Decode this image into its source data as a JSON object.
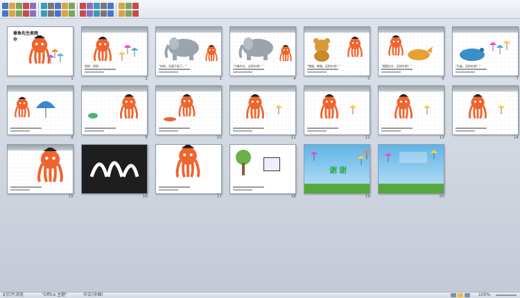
{
  "toolbar": {
    "row1_buttons": [
      "new",
      "open",
      "save",
      "print",
      "preview",
      "spell",
      "cut",
      "copy",
      "paste",
      "format-painter",
      "undo",
      "redo",
      "table",
      "chart",
      "sort",
      "drawing",
      "zoom",
      "help"
    ],
    "row2_buttons": [
      "font",
      "size",
      "bold",
      "italic",
      "underline",
      "shadow",
      "align-left",
      "center",
      "align-right",
      "justify",
      "numbering",
      "bullets",
      "indent",
      "outdent",
      "font-color",
      "styles",
      "search",
      "help"
    ]
  },
  "slides": [
    {
      "num": "1",
      "title": "章鱼先生卖雨伞",
      "theme": "title"
    },
    {
      "num": "2",
      "text": "阴阴、阴阴……",
      "theme": "octopus"
    },
    {
      "num": "3",
      "text": "\"哎呀，天要下雨了。\"",
      "theme": "elephant"
    },
    {
      "num": "4",
      "text": "\"大象先生，买把伞吧？\"",
      "theme": "elephant"
    },
    {
      "num": "5",
      "text": "\"熊猫、熊猫，买把伞吧？\"",
      "theme": "bear"
    },
    {
      "num": "6",
      "text": "\"狐狸先生，买把伞吧？\"",
      "theme": "fox"
    },
    {
      "num": "7",
      "text": "\"孔雀，买把伞吧？\"",
      "theme": "peacock"
    },
    {
      "num": "8",
      "text": "",
      "theme": "umbrella"
    },
    {
      "num": "9",
      "text": "",
      "theme": "chameleon"
    },
    {
      "num": "10",
      "text": "",
      "theme": "lizard"
    },
    {
      "num": "11",
      "text": "",
      "theme": "octopus-rain"
    },
    {
      "num": "12",
      "text": "",
      "theme": "octopus-rain"
    },
    {
      "num": "13",
      "text": "",
      "theme": "octopus-rain"
    },
    {
      "num": "14",
      "text": "",
      "theme": "octopus-rain"
    },
    {
      "num": "15",
      "text": "",
      "theme": "octopus-big"
    },
    {
      "num": "16",
      "text": "",
      "theme": "dark"
    },
    {
      "num": "17",
      "text": "",
      "theme": "octopus-red"
    },
    {
      "num": "18",
      "text": "",
      "theme": "tree"
    },
    {
      "num": "19",
      "text": "谢谢",
      "theme": "thanks"
    },
    {
      "num": "20",
      "text": "",
      "theme": "thanks2"
    }
  ],
  "statusbar": {
    "slide_info": "幻灯片浏览",
    "theme": "\"Office 主题\"",
    "language": "中文(中国)",
    "zoom": "100%"
  },
  "colors": {
    "octopus": "#f0642d",
    "sky": "#5fb4e6",
    "grass": "#57a83c",
    "cloud": "#9aa1a7"
  }
}
